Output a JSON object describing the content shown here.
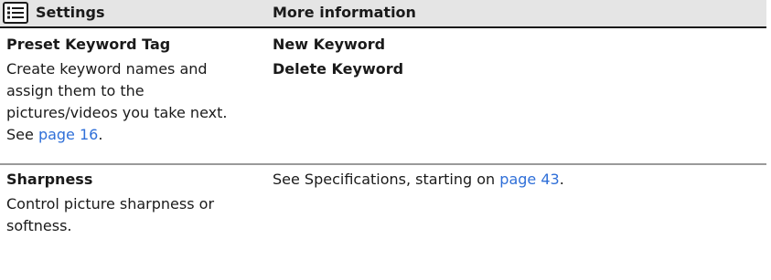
{
  "header": {
    "settings_label": "Settings",
    "settings_icon": "menu-list-icon",
    "more_info_label": "More information"
  },
  "rows": [
    {
      "setting_title": "Preset Keyword Tag",
      "description_lines": [
        "Create keyword names and",
        "assign them to the",
        "pictures/videos you take next."
      ],
      "see_prefix": "See ",
      "see_link": "page 16",
      "see_suffix": ".",
      "more_info": [
        "New Keyword",
        "Delete Keyword"
      ]
    },
    {
      "setting_title": "Sharpness",
      "description_lines": [
        "Control picture sharpness or",
        "softness."
      ],
      "more_info_prefix": "See Specifications, starting on ",
      "more_info_link": "page 43",
      "more_info_suffix": "."
    }
  ],
  "colors": {
    "header_bg": "#e5e5e5",
    "link": "#2f6fd8",
    "text": "#1a1a1a"
  }
}
